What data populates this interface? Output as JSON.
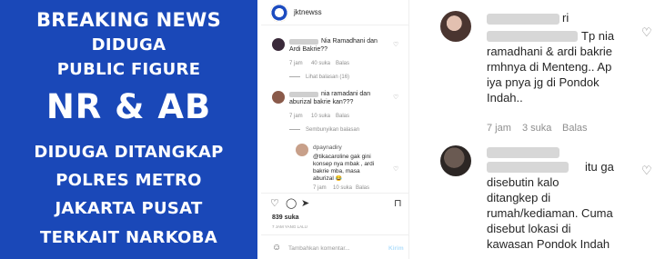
{
  "banner": {
    "line1": "BREAKING NEWS",
    "line2": "DIDUGA",
    "line3": "PUBLIC FIGURE",
    "line4": "NR & AB",
    "line5": "DIDUGA DITANGKAP",
    "line6": "POLRES METRO",
    "line7": "JAKARTA PUSAT",
    "line8": "TERKAIT NARKOBA"
  },
  "ig": {
    "username": "jktnewss",
    "comments": [
      {
        "text_line1": "Nia Ramadhani dan",
        "text_line2": "Ardi Bakrie??",
        "time": "7 jam",
        "likes": "40 suka",
        "reply": "Balas",
        "view_replies": "Lihat balasan (16)"
      },
      {
        "text_line1": "nia ramadani dan",
        "text_line2": "aburizal bakrie kan???",
        "time": "7 jam",
        "likes": "10 suka",
        "reply": "Balas",
        "view_replies": "Sembunyikan balasan"
      }
    ],
    "reply": {
      "user": "dpaynadiry",
      "line1": "@tikacaroline gak gini",
      "line2": "konsep nya mbak , ardi",
      "line3": "bakrie mba, masa",
      "line4": "aburizal",
      "emoji": "😂",
      "time": "7 jam",
      "likes": "10 suka",
      "reply_label": "Balas"
    },
    "likes": "839 suka",
    "post_time": "7 JAM YANG LALU",
    "add_comment_placeholder": "Tambahkan komentar...",
    "send_label": "Kirim"
  },
  "zoom": {
    "comment1": {
      "name_tail": "ri",
      "line1": "Tp nia",
      "line2": "ramadhani & ardi bakrie",
      "line3": "rmhnya di Menteng.. Ap",
      "line4": "iya pnya jg di Pondok",
      "line5": "Indah..",
      "time": "7 jam",
      "likes": "3 suka",
      "reply": "Balas"
    },
    "comment2": {
      "line1": "itu ga",
      "line2": "disebutin kalo",
      "line3": "ditangkep di",
      "line4": "rumah/kediaman. Cuma",
      "line5": "disebut lokasi di",
      "line6": "kawasan Pondok Indah"
    }
  }
}
